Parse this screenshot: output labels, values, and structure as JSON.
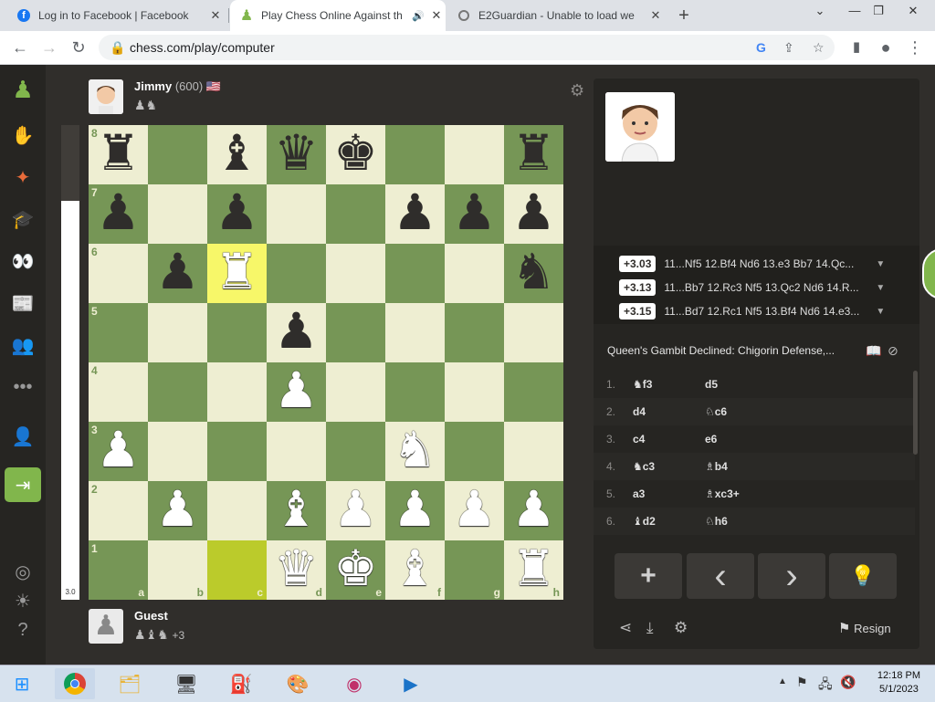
{
  "browser": {
    "tabs": [
      {
        "label": "Log in to Facebook | Facebook",
        "icon": "facebook-icon"
      },
      {
        "label": "Play Chess Online Against th",
        "icon": "chess-pawn-icon",
        "active": true
      },
      {
        "label": "E2Guardian - Unable to load we",
        "icon": "globe-icon"
      }
    ],
    "new_tab": "+",
    "url": "chess.com/play/computer"
  },
  "top_player": {
    "name": "Jimmy",
    "rating": "(600)",
    "flag": "🇺🇸",
    "captured": "♟♞"
  },
  "bottom_player": {
    "name": "Guest",
    "captured": "♟♝♞",
    "advantage": "+3"
  },
  "eval_bar": {
    "value": "3.0",
    "white_fraction": 0.84
  },
  "board": {
    "ranks": [
      "8",
      "7",
      "6",
      "5",
      "4",
      "3",
      "2",
      "1"
    ],
    "files": [
      "a",
      "b",
      "c",
      "d",
      "e",
      "f",
      "g",
      "h"
    ],
    "position": [
      [
        "bR",
        "",
        "bB",
        "bQ",
        "bK",
        "",
        "",
        "bR"
      ],
      [
        "bP",
        "",
        "bP",
        "",
        "",
        "bP",
        "bP",
        "bP"
      ],
      [
        "",
        "bP",
        "wR",
        "",
        "",
        "",
        "",
        "bN"
      ],
      [
        "",
        "",
        "",
        "bP",
        "",
        "",
        "",
        ""
      ],
      [
        "",
        "",
        "",
        "wP",
        "",
        "",
        "",
        ""
      ],
      [
        "wP",
        "",
        "",
        "",
        "",
        "wN",
        "",
        ""
      ],
      [
        "",
        "wP",
        "",
        "wB",
        "wP",
        "wP",
        "wP",
        "wP"
      ],
      [
        "",
        "",
        "",
        "wQ",
        "wK",
        "wB",
        "",
        "wR"
      ]
    ]
  },
  "engine_lines": [
    {
      "score": "+3.03",
      "line": "11...Nf5 12.Bf4 Nd6 13.e3 Bb7 14.Qc..."
    },
    {
      "score": "+3.13",
      "line": "11...Bb7 12.Rc3 Nf5 13.Qc2 Nd6 14.R..."
    },
    {
      "score": "+3.15",
      "line": "11...Bd7 12.Rc1 Nf5 13.Bf4 Nd6 14.e3..."
    }
  ],
  "opening": "Queen's Gambit Declined: Chigorin Defense,...",
  "moves": [
    {
      "num": "1.",
      "white": "♞f3",
      "black": "d5"
    },
    {
      "num": "2.",
      "white": "d4",
      "black": "♘c6"
    },
    {
      "num": "3.",
      "white": "c4",
      "black": "e6"
    },
    {
      "num": "4.",
      "white": "♞c3",
      "black": "♗b4"
    },
    {
      "num": "5.",
      "white": "a3",
      "black": "♗xc3+"
    },
    {
      "num": "6.",
      "white": "♝d2",
      "black": "♘h6"
    }
  ],
  "controls": {
    "add": "+",
    "prev": "‹",
    "next": "›",
    "hint": "💡",
    "resign": "Resign"
  },
  "taskbar": {
    "time": "12:18 PM",
    "date": "5/1/2023"
  },
  "colors": {
    "chess_green": "#81b64c",
    "board_light": "#eeeed2",
    "board_dark": "#769656",
    "highlight": "#f7f769"
  }
}
